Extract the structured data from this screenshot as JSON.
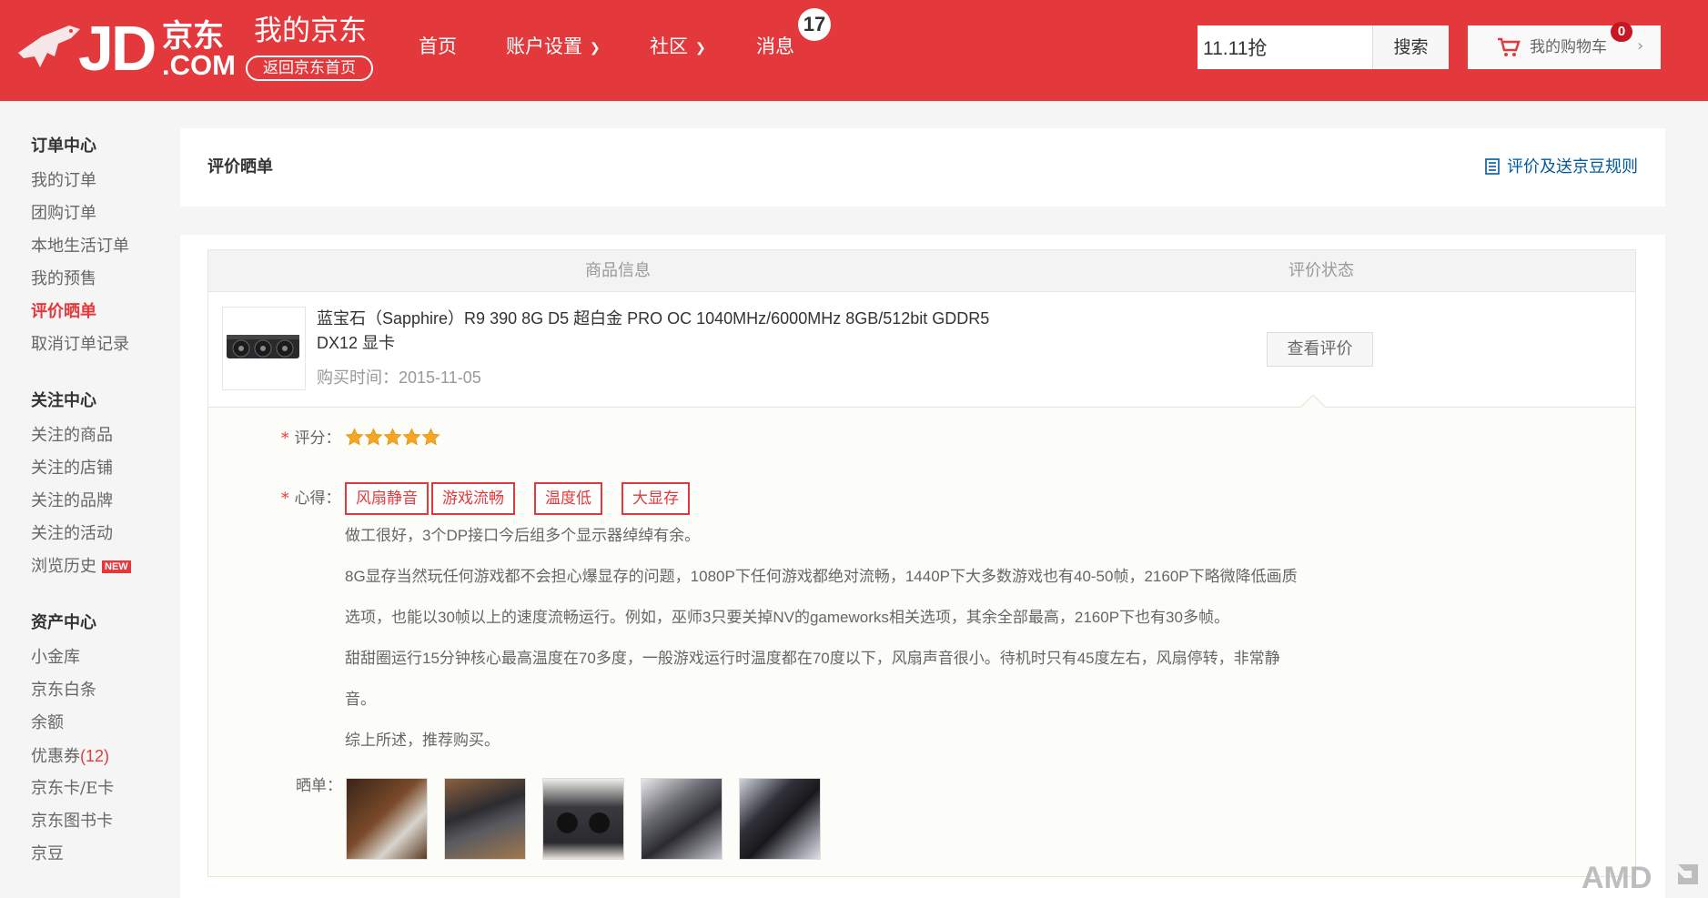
{
  "header": {
    "logo_text": "JD",
    "logo_cn": "京东",
    "logo_com": ".COM",
    "my_jd": "我的京东",
    "back_home": "返回京东首页",
    "nav": [
      {
        "label": "首页"
      },
      {
        "label": "账户设置"
      },
      {
        "label": "社区"
      },
      {
        "label": "消息"
      }
    ],
    "message_count": "17",
    "search": {
      "value": "11.11抢",
      "button": "搜索"
    },
    "cart": {
      "label": "我的购物车",
      "count": "0"
    }
  },
  "sidebar": {
    "sections": [
      {
        "title": "订单中心",
        "items": [
          "我的订单",
          "团购订单",
          "本地生活订单",
          "我的预售",
          "评价晒单",
          "取消订单记录"
        ]
      },
      {
        "title": "关注中心",
        "items": [
          "关注的商品",
          "关注的店铺",
          "关注的品牌",
          "关注的活动",
          "浏览历史"
        ]
      },
      {
        "title": "资产中心",
        "items": [
          "小金库",
          "京东白条",
          "余额",
          "优惠券",
          "京东卡/E卡",
          "京东图书卡",
          "京豆"
        ]
      }
    ],
    "new_badge": "NEW",
    "coupon_count": "(12)",
    "active_item": "评价晒单"
  },
  "page": {
    "title": "评价晒单",
    "rules_link": "评价及送京豆规则"
  },
  "table": {
    "headers": [
      "商品信息",
      "评价状态"
    ],
    "product": {
      "name_line1": "蓝宝石（Sapphire）R9 390 8G D5 超白金 PRO OC 1040MHz/6000MHz 8GB/512bit GDDR5",
      "name_line2": "DX12 显卡",
      "purchase_time": "购买时间：2015-11-05",
      "action": "查看评价"
    }
  },
  "review": {
    "rating_label": "评分：",
    "rating": 5,
    "impression_label": "心得：",
    "tags": [
      "风扇静音",
      "游戏流畅",
      "温度低",
      "大显存"
    ],
    "lines": [
      "做工很好，3个DP接口今后组多个显示器绰绰有余。",
      "8G显存当然玩任何游戏都不会担心爆显存的问题，1080P下任何游戏都绝对流畅，1440P下大多数游戏也有40-50帧，2160P下略微降低画质",
      "选项，也能以30帧以上的速度流畅运行。例如，巫师3只要关掉NV的gameworks相关选项，其余全部最高，2160P下也有30多帧。",
      "甜甜圈运行15分钟核心最高温度在70多度，一般游戏运行时温度都在70度以下，风扇声音很小。待机时只有45度左右，风扇停转，非常静",
      "音。",
      "综上所述，推荐购买。"
    ],
    "photos_label": "晒单：",
    "photos": [
      "photo-1",
      "photo-2",
      "photo-3",
      "photo-4",
      "photo-5"
    ]
  },
  "watermark": "AMD",
  "colors": {
    "brand_red": "#e4393c",
    "link_blue": "#005aa0",
    "star_gold": "#f5a623"
  }
}
